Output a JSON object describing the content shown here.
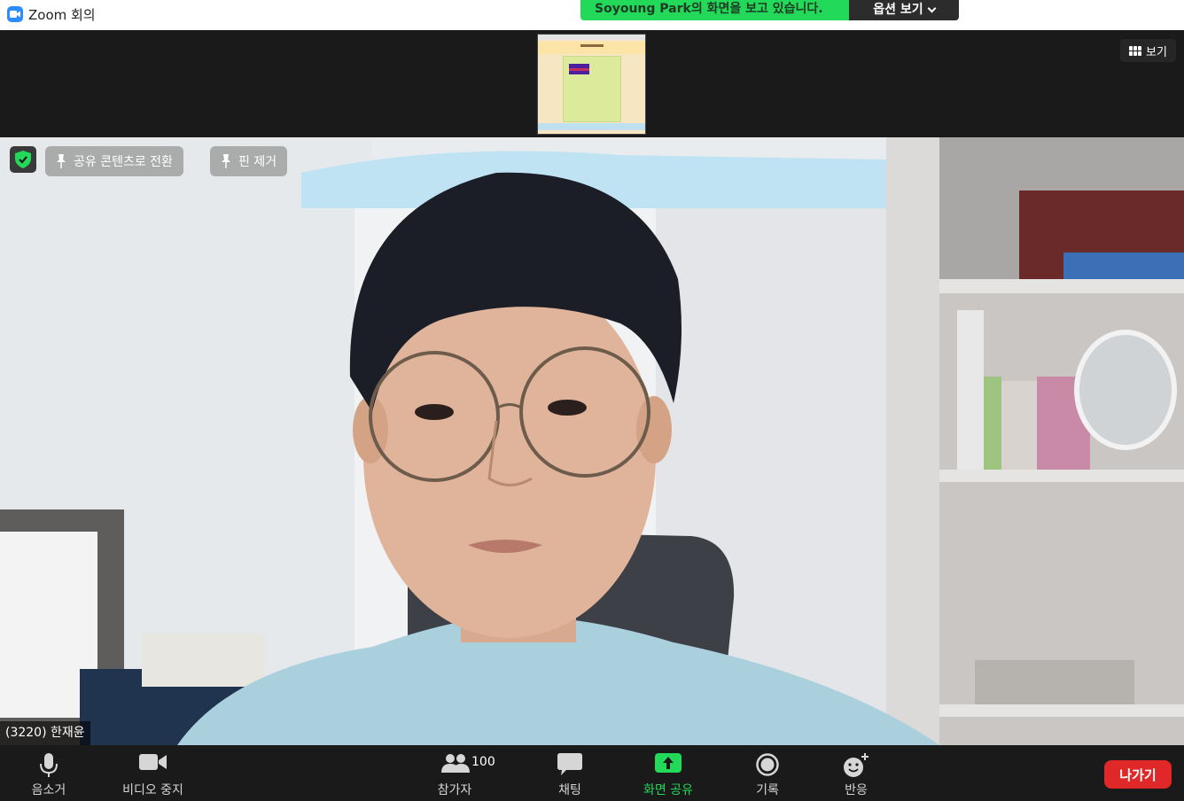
{
  "window": {
    "title": "Zoom 회의",
    "icon": "zoom-camera-icon"
  },
  "share_banner": {
    "text": "Soyoung  Park의 화면을 보고 있습니다.",
    "options_label": "옵션 보기",
    "accent": "#23d959"
  },
  "view_button": {
    "label": "보기",
    "icon": "gallery-grid-icon"
  },
  "thumbnail": {
    "title": "Shared screen thumbnail"
  },
  "video": {
    "security_icon": "shield-check-icon",
    "switch_label": "공유 콘텐츠로 전환",
    "unpin_label": "핀 제거",
    "participant_name": "(3220) 한재윤"
  },
  "toolbar": {
    "mute_label": "음소거",
    "video_label": "비디오 중지",
    "participants_label": "참가자",
    "participants_count": "100",
    "chat_label": "채팅",
    "share_label": "화면 공유",
    "record_label": "기록",
    "reactions_label": "반응",
    "leave_label": "나가기",
    "share_color": "#23d959",
    "leave_color": "#e02828"
  }
}
